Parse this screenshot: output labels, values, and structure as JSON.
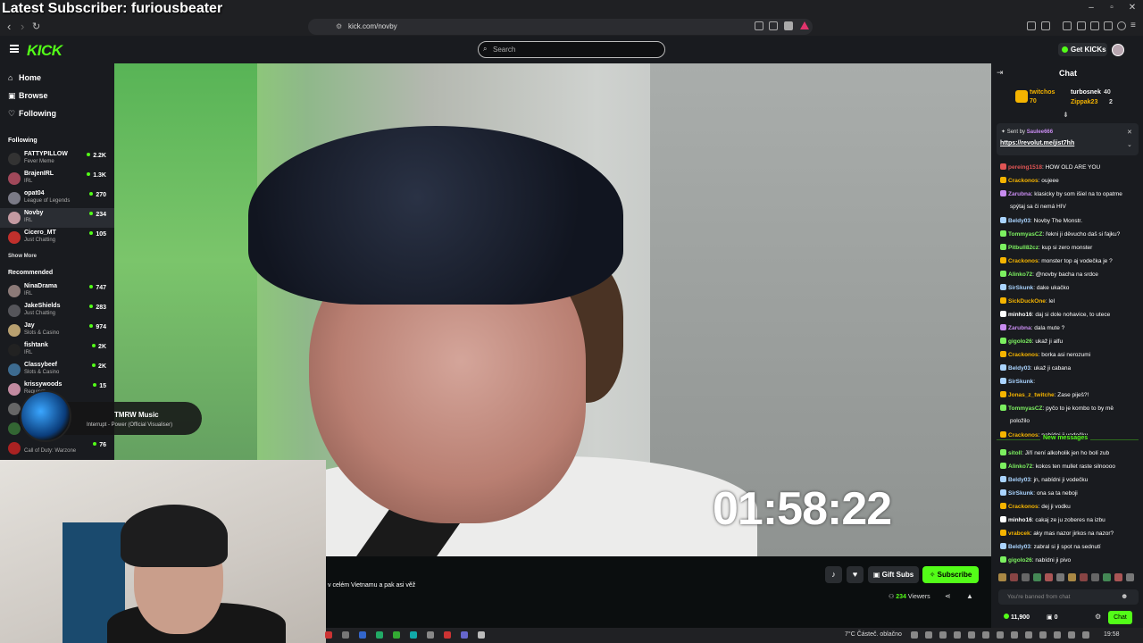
{
  "overlay": {
    "latest_subscriber": "Latest Subscriber: furiousbeater"
  },
  "browser": {
    "url": "kick.com/novby"
  },
  "header": {
    "logo": "KICK",
    "search_placeholder": "Search",
    "get_kicks": "Get KICKs"
  },
  "sidebar": {
    "nav": [
      {
        "label": "Home",
        "icon": "home-icon"
      },
      {
        "label": "Browse",
        "icon": "browse-icon"
      },
      {
        "label": "Following",
        "icon": "heart-icon"
      }
    ],
    "following_title": "Following",
    "following": [
      {
        "name": "FATTYPILLOW",
        "category": "Fever Meme",
        "viewers": "2.2K",
        "color": "#333333"
      },
      {
        "name": "BrajenIRL",
        "category": "IRL",
        "viewers": "1.3K",
        "color": "#a0485a"
      },
      {
        "name": "opat04",
        "category": "League of Legends",
        "viewers": "270",
        "color": "#7a7a86"
      },
      {
        "name": "Novby",
        "category": "IRL",
        "viewers": "234",
        "color": "#c49aa2"
      },
      {
        "name": "Cicero_MT",
        "category": "Just Chatting",
        "viewers": "105",
        "color": "#c0302c"
      }
    ],
    "show_more_1": "Show More",
    "recommended_title": "Recommended",
    "recommended": [
      {
        "name": "NinaDrama",
        "category": "IRL",
        "viewers": "747",
        "color": "#8c7a78"
      },
      {
        "name": "JakeShields",
        "category": "Just Chatting",
        "viewers": "283",
        "color": "#55555a"
      },
      {
        "name": "Jay",
        "category": "Slots & Casino",
        "viewers": "974",
        "color": "#b8a070"
      },
      {
        "name": "fishtank",
        "category": "IRL",
        "viewers": "2K",
        "color": "#222222"
      },
      {
        "name": "Classybeef",
        "category": "Slots & Casino",
        "viewers": "2K",
        "color": "#3d6b90"
      },
      {
        "name": "krissywoods",
        "category": "Requiem",
        "viewers": "15",
        "color": "#c28aa0"
      },
      {
        "name": "",
        "category": "",
        "viewers": "",
        "color": "#666666"
      },
      {
        "name": "",
        "category": "",
        "viewers": "",
        "color": "#336633"
      },
      {
        "name": "",
        "category": "Call of Duty: Warzone",
        "viewers": "76",
        "color": "#aa2222"
      }
    ]
  },
  "music": {
    "title": "TMRW Music",
    "subtitle": "Interrupt - Power (Official Visualiser)"
  },
  "video": {
    "timer": "01:58:22"
  },
  "stream": {
    "title_fragment": "v celém Vietnamu a pak asi věž",
    "gift_subs": "Gift Subs",
    "subscribe": "Subscribe",
    "viewers_count": "234",
    "viewers_label": "Viewers"
  },
  "taskbar": {
    "weather": "7°C  Částeč. oblačno",
    "time": "19:58"
  },
  "chat": {
    "title": "Chat",
    "leaderboard": [
      {
        "name": "twitchos",
        "value": "70",
        "color": "#f5b400"
      },
      {
        "name": "turbosnek",
        "value": "40",
        "color": "#ffffff"
      },
      {
        "name": "Zippak23",
        "value": "2",
        "color": "#f5b400"
      }
    ],
    "pinned_sent_by": "Sent by",
    "pinned_user": "Saulee666",
    "pinned_link": "https://revolut.me/jist7hh",
    "messages": [
      {
        "user": "pereing1518",
        "text": "HOW OLD ARE YOU",
        "color": "#e05555"
      },
      {
        "user": "Crackonos",
        "text": "oujeee",
        "color": "#f5b400"
      },
      {
        "user": "Zarubna",
        "text": "klasicky by som išiel na to opatrne",
        "color": "#c88cf0"
      },
      {
        "user": "",
        "text": "spýtaj sa či nemá HIV",
        "color": "#c88cf0"
      },
      {
        "user": "Beldy03",
        "text": "Novby The Monstr.",
        "color": "#aad4ff"
      },
      {
        "user": "TommyasCZ",
        "text": "řekni ji děvucho daš si fajku?",
        "color": "#7cf060"
      },
      {
        "user": "Pitbull82cz",
        "text": "kup si zero monster",
        "color": "#7cf060"
      },
      {
        "user": "Crackonos",
        "text": "monster top aj vodečka je ?",
        "color": "#f5b400"
      },
      {
        "user": "Alinko72",
        "text": "@novby bacha na srdce",
        "color": "#7cf060"
      },
      {
        "user": "SirSkunk",
        "text": "dake ukačko",
        "color": "#aad4ff"
      },
      {
        "user": "SickDuckOne",
        "text": "lel",
        "color": "#f5b400"
      },
      {
        "user": "minho16",
        "text": "daj si dole nohavice, to utece",
        "color": "#ffffff"
      },
      {
        "user": "Zarubna",
        "text": "dala mute ?",
        "color": "#c88cf0"
      },
      {
        "user": "gigolo26",
        "text": "ukaž ji alfu",
        "color": "#7cf060"
      },
      {
        "user": "Crackonos",
        "text": "borka asi nerozumi",
        "color": "#f5b400"
      },
      {
        "user": "Beldy03",
        "text": "ukaž ji cabana",
        "color": "#aad4ff"
      },
      {
        "user": "SirSkunk",
        "text": "",
        "color": "#aad4ff"
      },
      {
        "user": "Jonas_z_twitche",
        "text": "Zase piješ?!",
        "color": "#f5b400"
      },
      {
        "user": "TommyasCZ",
        "text": "pyčo to je kombo to by mě",
        "color": "#7cf060"
      },
      {
        "user": "",
        "text": "položilo",
        "color": "#7cf060"
      },
      {
        "user": "Crackonos",
        "text": "nabídni ji vodečku",
        "color": "#f5b400"
      }
    ],
    "new_messages": "New messages",
    "new": [
      {
        "user": "sitoll",
        "text": "Jiří není alkoholik jen ho bolí zub",
        "color": "#7cf060"
      },
      {
        "user": "Alinko72",
        "text": "kokos ten mullet raste silnoooo",
        "color": "#7cf060"
      },
      {
        "user": "Beldy03",
        "text": "jn, nabídni ji vodečku",
        "color": "#aad4ff"
      },
      {
        "user": "SirSkunk",
        "text": "ona sa ta neboji",
        "color": "#aad4ff"
      },
      {
        "user": "Crackonos",
        "text": "dej ji vodku",
        "color": "#f5b400"
      },
      {
        "user": "minho16",
        "text": "cakaj ze ju zoberes na izbu",
        "color": "#ffffff"
      },
      {
        "user": "vrabcek",
        "text": "aky mas nazor jirkos na nazor?",
        "color": "#f5b400"
      },
      {
        "user": "Beldy03",
        "text": "zabral si ji spot na sednutí",
        "color": "#aad4ff"
      },
      {
        "user": "gigolo26",
        "text": "nabídni ji pivo",
        "color": "#7cf060"
      }
    ],
    "input_placeholder": "You're banned from chat",
    "kicks": "11,900",
    "points": "0",
    "chat_button": "Chat"
  }
}
